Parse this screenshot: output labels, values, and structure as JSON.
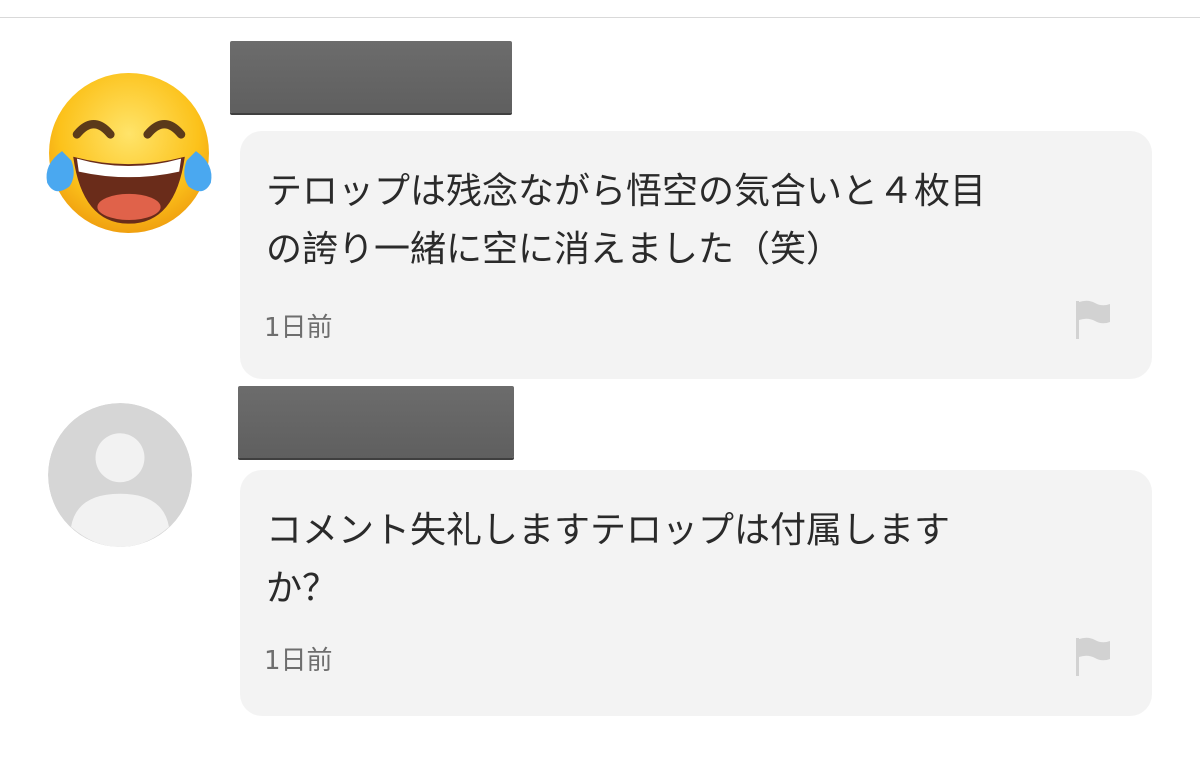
{
  "comments": [
    {
      "avatar_icon": "face-with-tears-of-joy-icon",
      "author_name": "",
      "text": "テロップは残念ながら悟空の気合いと４枚目\nの誇り一緒に空に消えました（笑）",
      "time": "1日前",
      "report_icon": "flag-icon"
    },
    {
      "avatar_icon": "default-user-icon",
      "author_name": "",
      "text": "コメント失礼しますテロップは付属します\nか？",
      "time": "1日前",
      "report_icon": "flag-icon"
    }
  ],
  "colors": {
    "bubble_bg": "#f3f3f3",
    "text": "#2a2a2a",
    "timestamp": "#6e6e6e",
    "flag": "#d2d2d2",
    "redaction": "#666666"
  }
}
